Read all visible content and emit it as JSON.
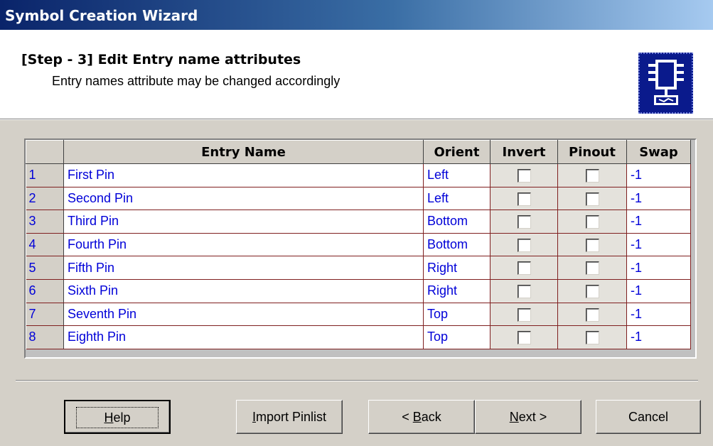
{
  "window": {
    "title": "Symbol Creation Wizard"
  },
  "header": {
    "step_title": "[Step - 3] Edit Entry name attributes",
    "step_subtitle": "Entry names attribute may be changed accordingly",
    "icon": "chip-symbol-icon"
  },
  "grid": {
    "columns": [
      "",
      "Entry Name",
      "Orient",
      "Invert",
      "Pinout",
      "Swap"
    ],
    "rows": [
      {
        "num": "1",
        "name": "First Pin",
        "orient": "Left",
        "invert": false,
        "pinout": false,
        "swap": "-1"
      },
      {
        "num": "2",
        "name": "Second Pin",
        "orient": "Left",
        "invert": false,
        "pinout": false,
        "swap": "-1"
      },
      {
        "num": "3",
        "name": "Third Pin",
        "orient": "Bottom",
        "invert": false,
        "pinout": false,
        "swap": "-1"
      },
      {
        "num": "4",
        "name": "Fourth Pin",
        "orient": "Bottom",
        "invert": false,
        "pinout": false,
        "swap": "-1"
      },
      {
        "num": "5",
        "name": "Fifth Pin",
        "orient": "Right",
        "invert": false,
        "pinout": false,
        "swap": "-1"
      },
      {
        "num": "6",
        "name": "Sixth Pin",
        "orient": "Right",
        "invert": false,
        "pinout": false,
        "swap": "-1"
      },
      {
        "num": "7",
        "name": "Seventh Pin",
        "orient": "Top",
        "invert": false,
        "pinout": false,
        "swap": "-1"
      },
      {
        "num": "8",
        "name": "Eighth Pin",
        "orient": "Top",
        "invert": false,
        "pinout": false,
        "swap": "-1"
      }
    ]
  },
  "buttons": {
    "help": {
      "before": "",
      "mnemonic": "H",
      "after": "elp"
    },
    "import": {
      "before": "",
      "mnemonic": "I",
      "after": "mport Pinlist"
    },
    "back": {
      "before": "< ",
      "mnemonic": "B",
      "after": "ack"
    },
    "next": {
      "before": "",
      "mnemonic": "N",
      "after": "ext >"
    },
    "cancel": {
      "before": "",
      "mnemonic": "",
      "after": "Cancel"
    }
  },
  "colors": {
    "title_start": "#0a246a",
    "title_end": "#a6caf0",
    "cell_text": "#0000d8",
    "grid_line": "#7f1f1f"
  }
}
